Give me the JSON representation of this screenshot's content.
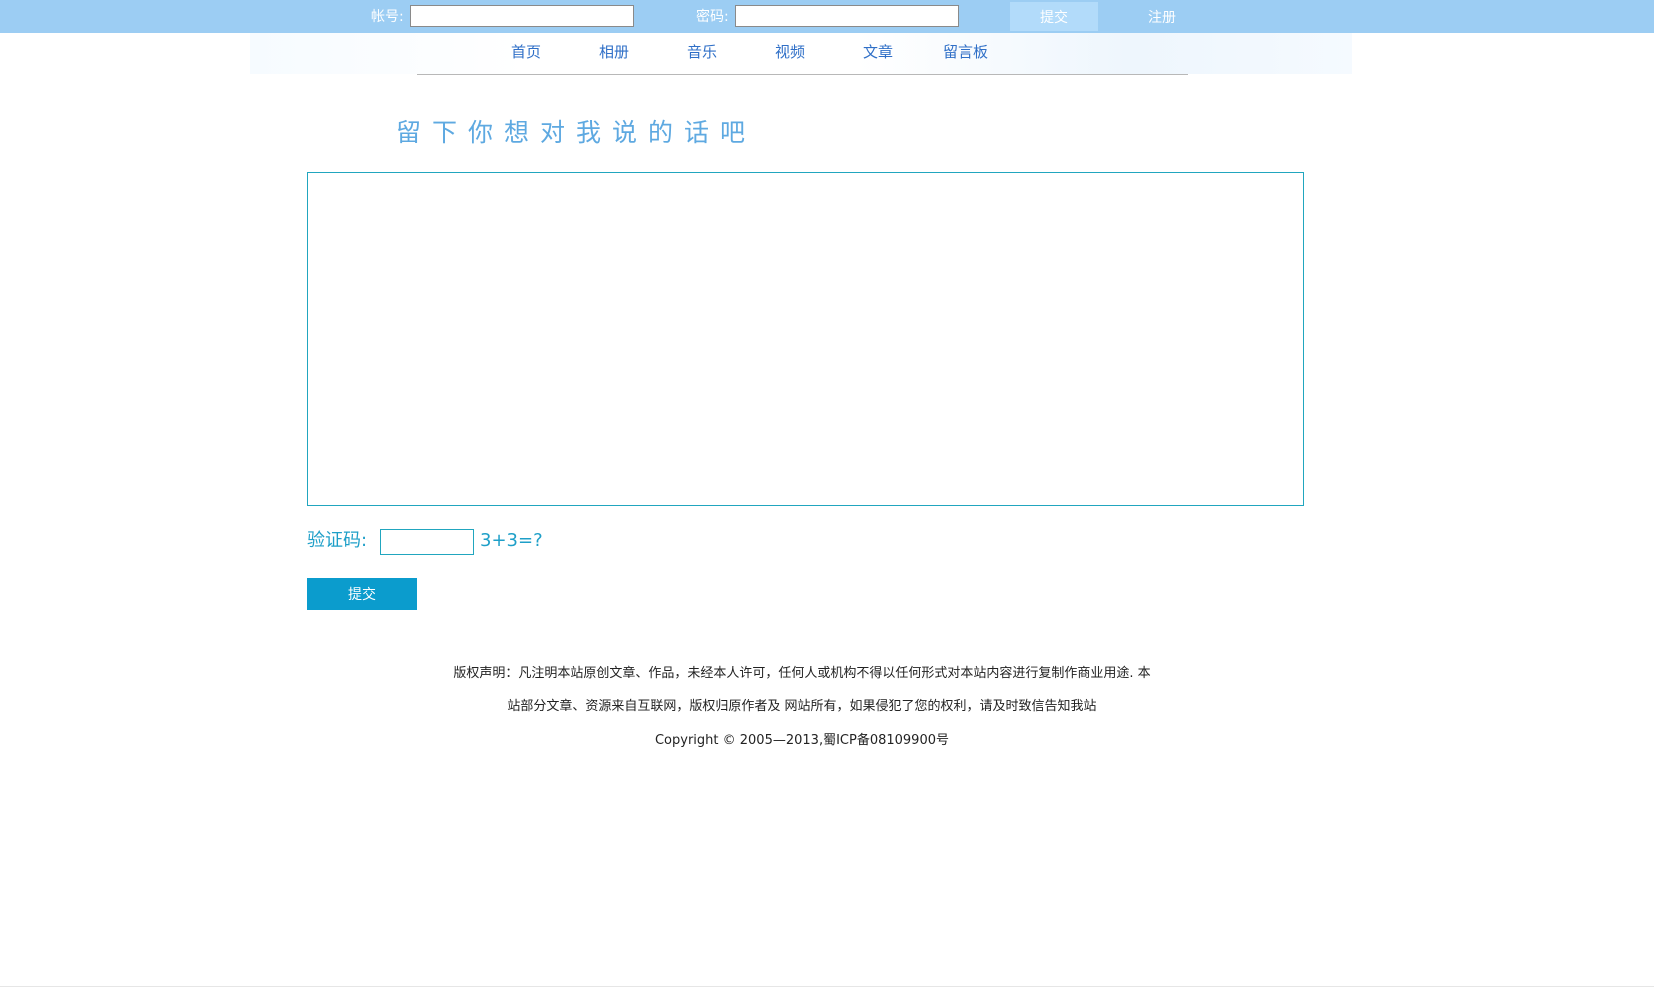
{
  "login": {
    "account_label": "帐号:",
    "password_label": "密码:",
    "submit_label": "提交",
    "register_label": "注册"
  },
  "nav": {
    "items": [
      "首页",
      "相册",
      "音乐",
      "视频",
      "文章",
      "留言板"
    ]
  },
  "guestbook": {
    "heading": "留下你想对我说的话吧",
    "captcha_label": "验证码:",
    "captcha_question": "3+3=?",
    "submit_label": "提交"
  },
  "footer": {
    "line1": "版权声明：凡注明本站原创文章、作品，未经本人许可，任何人或机构不得以任何形式对本站内容进行复制作商业用途. 本",
    "line2": "站部分文章、资源来自互联网，版权归原作者及 网站所有，如果侵犯了您的权利，请及时致信告知我站",
    "line3": "Copyright © 2005—2013,蜀ICP备08109900号"
  },
  "colors": {
    "topbar": "#9ccdf3",
    "accent": "#0b9ccd",
    "nav_link": "#2f6fc7",
    "heading": "#5ea9e1"
  }
}
